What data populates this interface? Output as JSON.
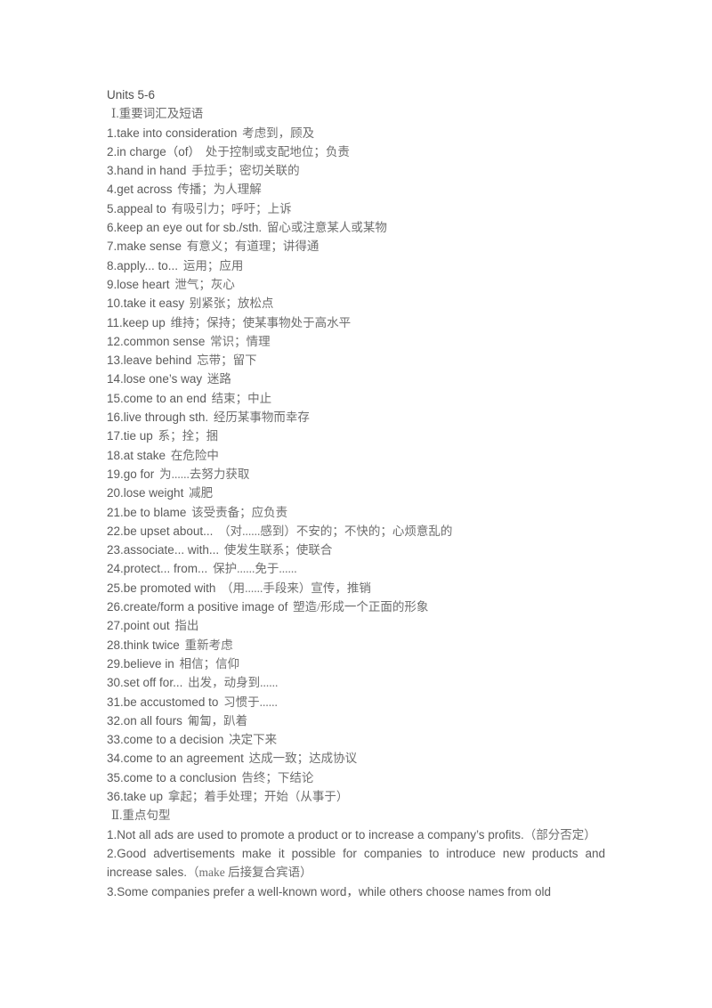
{
  "document": {
    "title": "Units 5-6",
    "sections": [
      {
        "heading": "Ⅰ.重要词汇及短语",
        "type": "vocabulary",
        "items": [
          {
            "num": "1.",
            "en": "take into consideration",
            "zh": "考虑到，顾及"
          },
          {
            "num": "2.",
            "en": "in charge（of）",
            "zh": "处于控制或支配地位；负责"
          },
          {
            "num": "3.",
            "en": "hand in hand",
            "zh": "手拉手；密切关联的"
          },
          {
            "num": "4.",
            "en": "get across",
            "zh": "传播；为人理解"
          },
          {
            "num": "5.",
            "en": "appeal to",
            "zh": "有吸引力；呼吁；上诉"
          },
          {
            "num": "6.",
            "en": "keep an eye out for sb./sth.",
            "zh": "留心或注意某人或某物"
          },
          {
            "num": "7.",
            "en": "make sense",
            "zh": "有意义；有道理；讲得通"
          },
          {
            "num": "8.",
            "en": "apply... to...",
            "zh": "运用；应用"
          },
          {
            "num": "9.",
            "en": "lose heart",
            "zh": "泄气；灰心"
          },
          {
            "num": "10.",
            "en": "take it easy",
            "zh": "别紧张；放松点"
          },
          {
            "num": "11.",
            "en": "keep up",
            "zh": "维持；保持；使某事物处于高水平"
          },
          {
            "num": "12.",
            "en": "common sense",
            "zh": "常识；情理"
          },
          {
            "num": "13.",
            "en": "leave behind",
            "zh": "忘带；留下"
          },
          {
            "num": "14.",
            "en": "lose one’s way",
            "zh": "迷路"
          },
          {
            "num": "15.",
            "en": "come to an end",
            "zh": "结束；中止"
          },
          {
            "num": "16.",
            "en": "live through sth.",
            "zh": "经历某事物而幸存"
          },
          {
            "num": "17.",
            "en": "tie up",
            "zh": "系；拴；捆"
          },
          {
            "num": "18.",
            "en": "at stake",
            "zh": "在危险中"
          },
          {
            "num": "19.",
            "en": "go for",
            "zh": "为......去努力获取"
          },
          {
            "num": "20.",
            "en": "lose weight",
            "zh": "减肥"
          },
          {
            "num": "21.",
            "en": "be to blame",
            "zh": "该受责备；应负责"
          },
          {
            "num": "22.",
            "en": "be upset about...",
            "zh": "（对......感到）不安的；不快的；心烦意乱的"
          },
          {
            "num": "23.",
            "en": "associate... with...",
            "zh": "使发生联系；使联合"
          },
          {
            "num": "24.",
            "en": "protect... from...",
            "zh": "保护......免于......"
          },
          {
            "num": "25.",
            "en": "be promoted with",
            "zh": "（用......手段来）宣传，推销"
          },
          {
            "num": "26.",
            "en": "create/form a positive image of",
            "zh": "塑造/形成一个正面的形象"
          },
          {
            "num": "27.",
            "en": "point out",
            "zh": "指出"
          },
          {
            "num": "28.",
            "en": "think twice",
            "zh": "重新考虑"
          },
          {
            "num": "29.",
            "en": "believe in",
            "zh": "相信；信仰"
          },
          {
            "num": "30.",
            "en": "set off for...",
            "zh": "出发，动身到......"
          },
          {
            "num": "31.",
            "en": "be accustomed to",
            "zh": "习惯于......"
          },
          {
            "num": "32.",
            "en": "on all fours",
            "zh": "匍匐，趴着"
          },
          {
            "num": "33.",
            "en": "come to a decision",
            "zh": "决定下来"
          },
          {
            "num": "34.",
            "en": "come to an agreement",
            "zh": "达成一致；达成协议"
          },
          {
            "num": "35.",
            "en": "come to a conclusion",
            "zh": "告终；下结论"
          },
          {
            "num": "36.",
            "en": "take up",
            "zh": "拿起；着手处理；开始（从事于）"
          }
        ]
      },
      {
        "heading": "Ⅱ.重点句型",
        "type": "sentences",
        "items": [
          {
            "num": "1.",
            "en": "Not all ads are used to promote a product or to increase a company’s profits.",
            "zh": "（部分否定）"
          },
          {
            "num": "2.",
            "en": "Good advertisements make it possible for companies to introduce new products and increase sales.",
            "zh": "（make 后接复合宾语）"
          },
          {
            "num": "3.",
            "en": "Some companies prefer a well-known word，while others choose names from old",
            "zh": ""
          }
        ]
      }
    ]
  }
}
